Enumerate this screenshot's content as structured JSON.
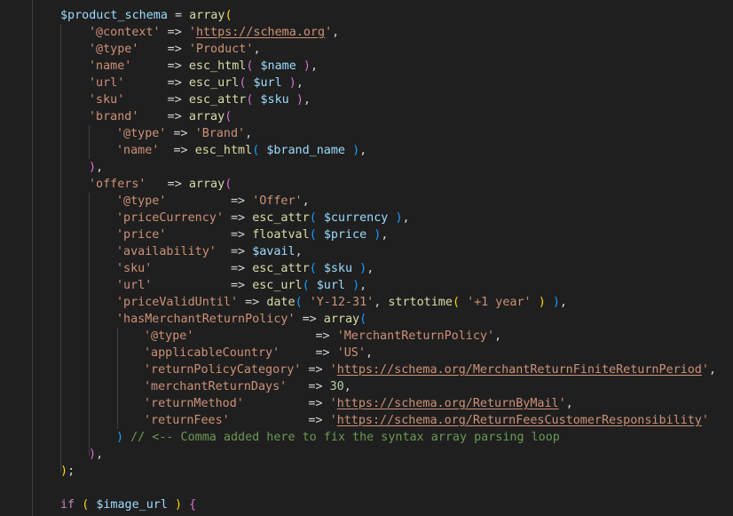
{
  "editor": {
    "background": "#1f1f1f",
    "theme": "dark-plus",
    "language": "php",
    "lines": [
      [
        {
          "t": "var",
          "v": "$product_schema"
        },
        {
          "t": "op",
          "v": " = "
        },
        {
          "t": "fn",
          "v": "array"
        },
        {
          "t": "p1",
          "v": "("
        }
      ],
      [
        {
          "t": "str",
          "v": "'@context'"
        },
        {
          "t": "op",
          "v": " => "
        },
        {
          "t": "str",
          "v": "'"
        },
        {
          "t": "url",
          "v": "https://schema.org"
        },
        {
          "t": "str",
          "v": "'"
        },
        {
          "t": "op",
          "v": ","
        }
      ],
      [
        {
          "t": "str",
          "v": "'@type'"
        },
        {
          "t": "op",
          "v": "    => "
        },
        {
          "t": "str",
          "v": "'Product'"
        },
        {
          "t": "op",
          "v": ","
        }
      ],
      [
        {
          "t": "str",
          "v": "'name'"
        },
        {
          "t": "op",
          "v": "     => "
        },
        {
          "t": "fn",
          "v": "esc_html"
        },
        {
          "t": "p2",
          "v": "("
        },
        {
          "t": "op",
          "v": " "
        },
        {
          "t": "var",
          "v": "$name"
        },
        {
          "t": "op",
          "v": " "
        },
        {
          "t": "p2",
          "v": ")"
        },
        {
          "t": "op",
          "v": ","
        }
      ],
      [
        {
          "t": "str",
          "v": "'url'"
        },
        {
          "t": "op",
          "v": "      => "
        },
        {
          "t": "fn",
          "v": "esc_url"
        },
        {
          "t": "p2",
          "v": "("
        },
        {
          "t": "op",
          "v": " "
        },
        {
          "t": "var",
          "v": "$url"
        },
        {
          "t": "op",
          "v": " "
        },
        {
          "t": "p2",
          "v": ")"
        },
        {
          "t": "op",
          "v": ","
        }
      ],
      [
        {
          "t": "str",
          "v": "'sku'"
        },
        {
          "t": "op",
          "v": "      => "
        },
        {
          "t": "fn",
          "v": "esc_attr"
        },
        {
          "t": "p2",
          "v": "("
        },
        {
          "t": "op",
          "v": " "
        },
        {
          "t": "var",
          "v": "$sku"
        },
        {
          "t": "op",
          "v": " "
        },
        {
          "t": "p2",
          "v": ")"
        },
        {
          "t": "op",
          "v": ","
        }
      ],
      [
        {
          "t": "str",
          "v": "'brand'"
        },
        {
          "t": "op",
          "v": "    => "
        },
        {
          "t": "fn",
          "v": "array"
        },
        {
          "t": "p2",
          "v": "("
        }
      ],
      [
        {
          "t": "str",
          "v": "'@type'"
        },
        {
          "t": "op",
          "v": " => "
        },
        {
          "t": "str",
          "v": "'Brand'"
        },
        {
          "t": "op",
          "v": ","
        }
      ],
      [
        {
          "t": "str",
          "v": "'name'"
        },
        {
          "t": "op",
          "v": "  => "
        },
        {
          "t": "fn",
          "v": "esc_html"
        },
        {
          "t": "p3",
          "v": "("
        },
        {
          "t": "op",
          "v": " "
        },
        {
          "t": "var",
          "v": "$brand_name"
        },
        {
          "t": "op",
          "v": " "
        },
        {
          "t": "p3",
          "v": ")"
        },
        {
          "t": "op",
          "v": ","
        }
      ],
      [
        {
          "t": "p2",
          "v": ")"
        },
        {
          "t": "op",
          "v": ","
        }
      ],
      [
        {
          "t": "str",
          "v": "'offers'"
        },
        {
          "t": "op",
          "v": "   => "
        },
        {
          "t": "fn",
          "v": "array"
        },
        {
          "t": "p2",
          "v": "("
        }
      ],
      [
        {
          "t": "str",
          "v": "'@type'"
        },
        {
          "t": "op",
          "v": "         => "
        },
        {
          "t": "str",
          "v": "'Offer'"
        },
        {
          "t": "op",
          "v": ","
        }
      ],
      [
        {
          "t": "str",
          "v": "'priceCurrency'"
        },
        {
          "t": "op",
          "v": " => "
        },
        {
          "t": "fn",
          "v": "esc_attr"
        },
        {
          "t": "p3",
          "v": "("
        },
        {
          "t": "op",
          "v": " "
        },
        {
          "t": "var",
          "v": "$currency"
        },
        {
          "t": "op",
          "v": " "
        },
        {
          "t": "p3",
          "v": ")"
        },
        {
          "t": "op",
          "v": ","
        }
      ],
      [
        {
          "t": "str",
          "v": "'price'"
        },
        {
          "t": "op",
          "v": "         => "
        },
        {
          "t": "fn",
          "v": "floatval"
        },
        {
          "t": "p3",
          "v": "("
        },
        {
          "t": "op",
          "v": " "
        },
        {
          "t": "var",
          "v": "$price"
        },
        {
          "t": "op",
          "v": " "
        },
        {
          "t": "p3",
          "v": ")"
        },
        {
          "t": "op",
          "v": ","
        }
      ],
      [
        {
          "t": "str",
          "v": "'availability'"
        },
        {
          "t": "op",
          "v": "  => "
        },
        {
          "t": "var",
          "v": "$avail"
        },
        {
          "t": "op",
          "v": ","
        }
      ],
      [
        {
          "t": "str",
          "v": "'sku'"
        },
        {
          "t": "op",
          "v": "           => "
        },
        {
          "t": "fn",
          "v": "esc_attr"
        },
        {
          "t": "p3",
          "v": "("
        },
        {
          "t": "op",
          "v": " "
        },
        {
          "t": "var",
          "v": "$sku"
        },
        {
          "t": "op",
          "v": " "
        },
        {
          "t": "p3",
          "v": ")"
        },
        {
          "t": "op",
          "v": ","
        }
      ],
      [
        {
          "t": "str",
          "v": "'url'"
        },
        {
          "t": "op",
          "v": "           => "
        },
        {
          "t": "fn",
          "v": "esc_url"
        },
        {
          "t": "p3",
          "v": "("
        },
        {
          "t": "op",
          "v": " "
        },
        {
          "t": "var",
          "v": "$url"
        },
        {
          "t": "op",
          "v": " "
        },
        {
          "t": "p3",
          "v": ")"
        },
        {
          "t": "op",
          "v": ","
        }
      ],
      [
        {
          "t": "str",
          "v": "'priceValidUntil'"
        },
        {
          "t": "op",
          "v": " => "
        },
        {
          "t": "fn",
          "v": "date"
        },
        {
          "t": "p3",
          "v": "("
        },
        {
          "t": "op",
          "v": " "
        },
        {
          "t": "str",
          "v": "'Y-12-31'"
        },
        {
          "t": "op",
          "v": ", "
        },
        {
          "t": "fn",
          "v": "strtotime"
        },
        {
          "t": "p1",
          "v": "("
        },
        {
          "t": "op",
          "v": " "
        },
        {
          "t": "str",
          "v": "'+1 year'"
        },
        {
          "t": "op",
          "v": " "
        },
        {
          "t": "p1",
          "v": ")"
        },
        {
          "t": "op",
          "v": " "
        },
        {
          "t": "p3",
          "v": ")"
        },
        {
          "t": "op",
          "v": ","
        }
      ],
      [
        {
          "t": "str",
          "v": "'hasMerchantReturnPolicy'"
        },
        {
          "t": "op",
          "v": " => "
        },
        {
          "t": "fn",
          "v": "array"
        },
        {
          "t": "p3",
          "v": "("
        }
      ],
      [
        {
          "t": "str",
          "v": "'@type'"
        },
        {
          "t": "op",
          "v": "                 => "
        },
        {
          "t": "str",
          "v": "'MerchantReturnPolicy'"
        },
        {
          "t": "op",
          "v": ","
        }
      ],
      [
        {
          "t": "str",
          "v": "'applicableCountry'"
        },
        {
          "t": "op",
          "v": "     => "
        },
        {
          "t": "str",
          "v": "'US'"
        },
        {
          "t": "op",
          "v": ","
        }
      ],
      [
        {
          "t": "str",
          "v": "'returnPolicyCategory'"
        },
        {
          "t": "op",
          "v": " => "
        },
        {
          "t": "str",
          "v": "'"
        },
        {
          "t": "url",
          "v": "https://schema.org/MerchantReturnFiniteReturnPeriod"
        },
        {
          "t": "str",
          "v": "'"
        },
        {
          "t": "op",
          "v": ","
        }
      ],
      [
        {
          "t": "str",
          "v": "'merchantReturnDays'"
        },
        {
          "t": "op",
          "v": "   => "
        },
        {
          "t": "num",
          "v": "30"
        },
        {
          "t": "op",
          "v": ","
        }
      ],
      [
        {
          "t": "str",
          "v": "'returnMethod'"
        },
        {
          "t": "op",
          "v": "         => "
        },
        {
          "t": "str",
          "v": "'"
        },
        {
          "t": "url",
          "v": "https://schema.org/ReturnByMail"
        },
        {
          "t": "str",
          "v": "'"
        },
        {
          "t": "op",
          "v": ","
        }
      ],
      [
        {
          "t": "str",
          "v": "'returnFees'"
        },
        {
          "t": "op",
          "v": "           => "
        },
        {
          "t": "str",
          "v": "'"
        },
        {
          "t": "url",
          "v": "https://schema.org/ReturnFeesCustomerResponsibility"
        },
        {
          "t": "str",
          "v": "'"
        }
      ],
      [
        {
          "t": "p3",
          "v": ")"
        },
        {
          "t": "op",
          "v": " "
        },
        {
          "t": "cmt",
          "v": "// <-- Comma added here to fix the syntax array parsing loop"
        }
      ],
      [
        {
          "t": "p2",
          "v": ")"
        },
        {
          "t": "op",
          "v": ","
        }
      ],
      [
        {
          "t": "p1",
          "v": ")"
        },
        {
          "t": "op",
          "v": ";"
        }
      ],
      [],
      [
        {
          "t": "ctl",
          "v": "if"
        },
        {
          "t": "op",
          "v": " "
        },
        {
          "t": "p1",
          "v": "("
        },
        {
          "t": "op",
          "v": " "
        },
        {
          "t": "var",
          "v": "$image_url"
        },
        {
          "t": "op",
          "v": " "
        },
        {
          "t": "p1",
          "v": ")"
        },
        {
          "t": "op",
          "v": " "
        },
        {
          "t": "p2",
          "v": "{"
        }
      ]
    ]
  }
}
